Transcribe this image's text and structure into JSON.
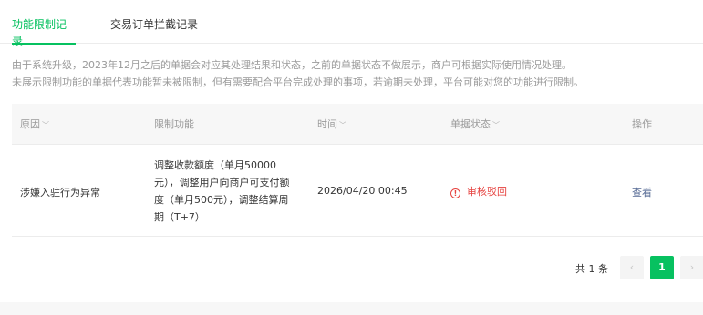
{
  "tabs": [
    {
      "label": "功能限制记录",
      "active": true
    },
    {
      "label": "交易订单拦截记录",
      "active": false
    }
  ],
  "notices": [
    "由于系统升级，2023年12月之后的单据会对应其处理结果和状态，之前的单据状态不做展示，商户可根据实际使用情况处理。",
    "未展示限制功能的单据代表功能暂未被限制，但有需要配合平台完成处理的事项，若逾期未处理，平台可能对您的功能进行限制。"
  ],
  "table": {
    "headers": {
      "reason": "原因",
      "func": "限制功能",
      "time": "时间",
      "status": "单据状态",
      "op": "操作"
    },
    "rows": [
      {
        "reason": "涉嫌入驻行为异常",
        "func": "调整收款额度（单月50000\n元），调整用户向商户可支付额\n度（单月500元），调整结算周\n期（T+7）",
        "time": "2026/04/20 00:45",
        "status": "审核驳回",
        "op": "查看"
      }
    ]
  },
  "pagination": {
    "total": "共 1 条",
    "prev_icon": "chevron-left-icon",
    "current_page": "1",
    "next_icon": "chevron-right-icon"
  },
  "colors": {
    "accent": "#07c160",
    "danger": "#e64340",
    "link": "#576b95",
    "muted": "#9a9a9a"
  }
}
